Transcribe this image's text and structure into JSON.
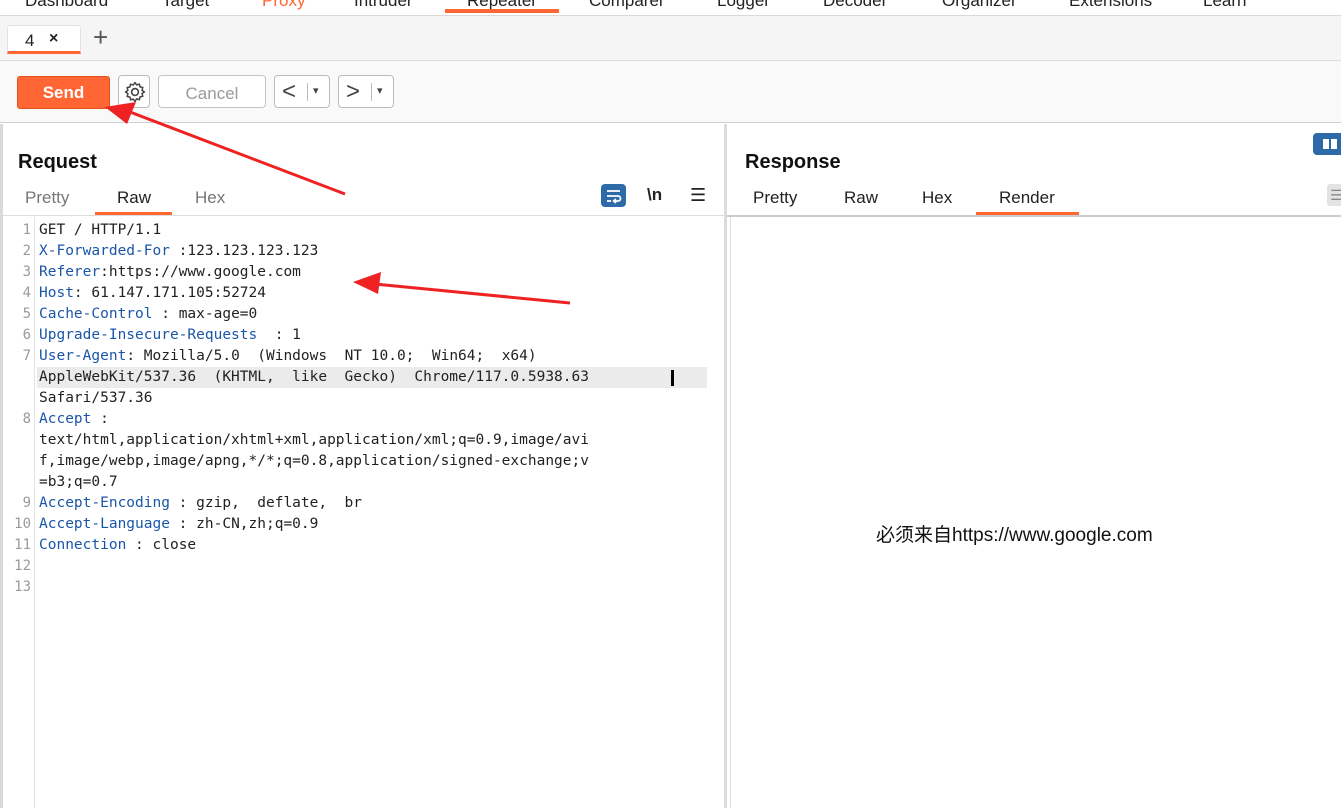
{
  "top_nav": {
    "items": [
      "Dashboard",
      "Target",
      "Proxy",
      "Intruder",
      "Repeater",
      "Comparer",
      "Logger",
      "Decoder",
      "Organizer",
      "Extensions",
      "Learn"
    ],
    "active": "Repeater"
  },
  "tabs": {
    "items": [
      {
        "label": "4",
        "close": "×"
      }
    ],
    "add_label": "+"
  },
  "toolbar": {
    "send_label": "Send",
    "cancel_label": "Cancel",
    "back_label": "<",
    "forward_label": ">",
    "dropdown_caret": "▾"
  },
  "request": {
    "title": "Request",
    "view_tabs": [
      "Pretty",
      "Raw",
      "Hex"
    ],
    "active_view": "Raw",
    "newline_toggle": "\\n",
    "menu": "☰",
    "lines": [
      {
        "num": "1",
        "key": "",
        "sep": "",
        "value": "GET / HTTP/1.1"
      },
      {
        "num": "2",
        "key": "X-Forwarded-For",
        "sep": " :",
        "value": "123.123.123.123"
      },
      {
        "num": "3",
        "key": "Referer",
        "sep": ":",
        "value": "https://www.google.com"
      },
      {
        "num": "4",
        "key": "Host",
        "sep": ": ",
        "value": "61.147.171.105:52724"
      },
      {
        "num": "5",
        "key": "Cache-Control",
        "sep": " : ",
        "value": "max-age=0"
      },
      {
        "num": "6",
        "key": "Upgrade-Insecure-Requests",
        "sep": "  : ",
        "value": "1"
      },
      {
        "num": "7",
        "key": "User-Agent",
        "sep": ": ",
        "value": "Mozilla/5.0  (Windows  NT 10.0;  Win64;  x64)"
      },
      {
        "num": "",
        "key": "",
        "sep": "",
        "value": "AppleWebKit/537.36  (KHTML,  like  Gecko)  Chrome/117.0.5938.63"
      },
      {
        "num": "",
        "key": "",
        "sep": "",
        "value": "Safari/537.36"
      },
      {
        "num": "8",
        "key": "Accept",
        "sep": " :",
        "value": ""
      },
      {
        "num": "",
        "key": "",
        "sep": "",
        "value": "text/html,application/xhtml+xml,application/xml;q=0.9,image/avi"
      },
      {
        "num": "",
        "key": "",
        "sep": "",
        "value": "f,image/webp,image/apng,*/*;q=0.8,application/signed-exchange;v"
      },
      {
        "num": "",
        "key": "",
        "sep": "",
        "value": "=b3;q=0.7"
      },
      {
        "num": "9",
        "key": "Accept-Encoding",
        "sep": " : ",
        "value": "gzip,  deflate,  br"
      },
      {
        "num": "10",
        "key": "Accept-Language",
        "sep": " : ",
        "value": "zh-CN,zh;q=0.9"
      },
      {
        "num": "11",
        "key": "Connection",
        "sep": " : ",
        "value": "close"
      },
      {
        "num": "12",
        "key": "",
        "sep": "",
        "value": ""
      },
      {
        "num": "13",
        "key": "",
        "sep": "",
        "value": ""
      }
    ]
  },
  "response": {
    "title": "Response",
    "view_tabs": [
      "Pretty",
      "Raw",
      "Hex",
      "Render"
    ],
    "active_view": "Render",
    "rendered_text": "必须来自https://www.google.com"
  },
  "colors": {
    "accent": "#ff6633",
    "header_key": "#1a56a8",
    "annotation": "#ee2222",
    "icon_blue": "#2f6aa8"
  }
}
